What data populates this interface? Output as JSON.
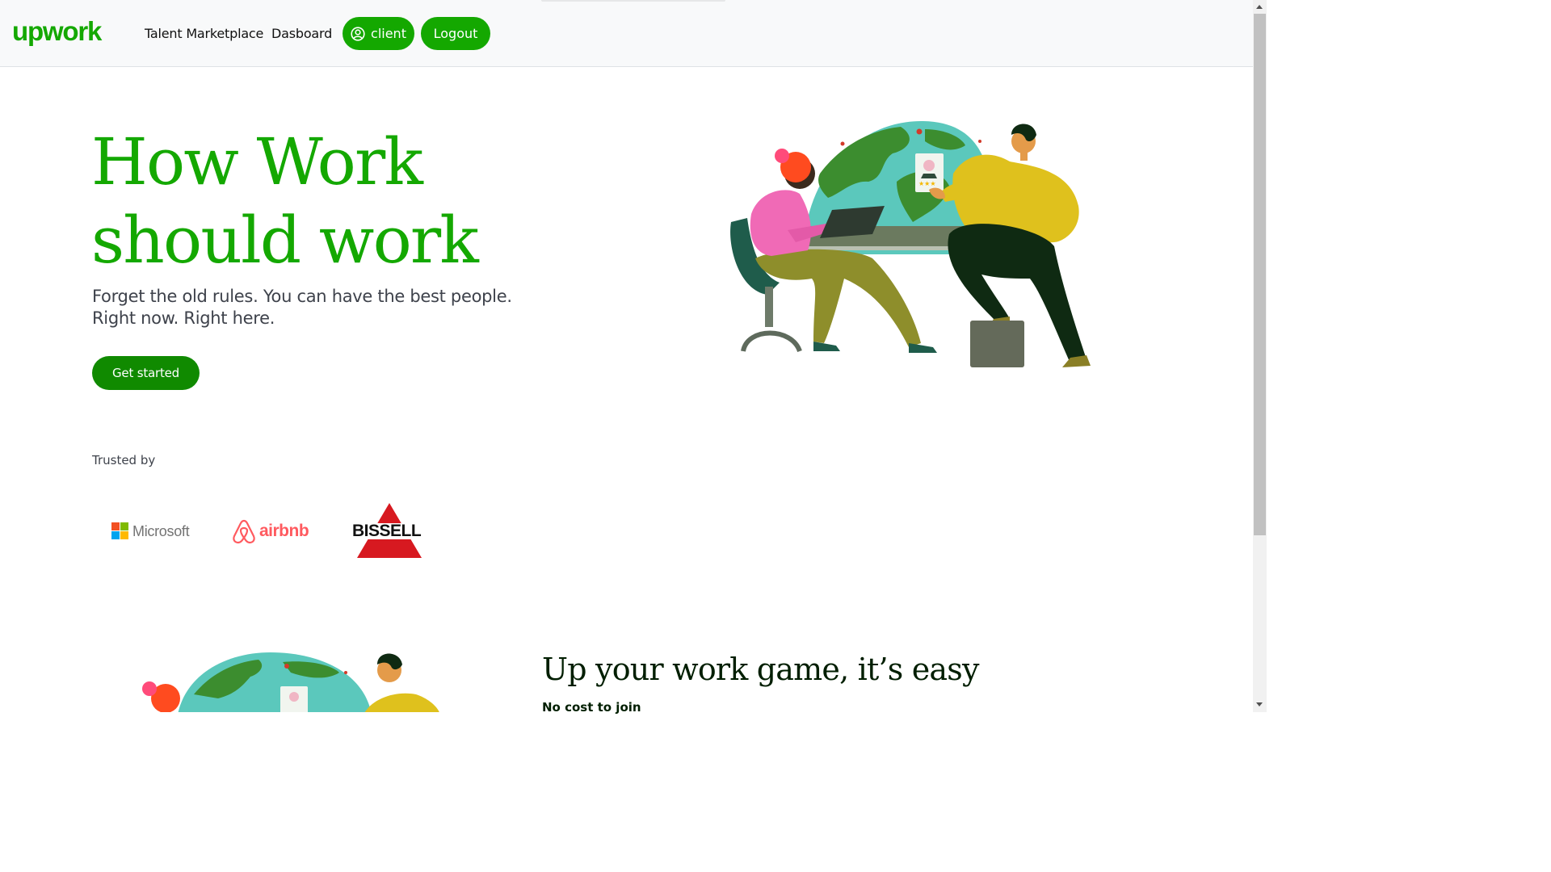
{
  "header": {
    "logo_text": "upwork",
    "nav": {
      "talent_marketplace": "Talent Marketplace",
      "dashboard": "Dasboard"
    },
    "client_label": "client",
    "logout_label": "Logout"
  },
  "hero": {
    "title_line1": "How Work",
    "title_line2": "should work",
    "subtitle_line1": "Forget the old rules. You can have the best people.",
    "subtitle_line2": "Right now. Right here.",
    "cta_label": "Get started"
  },
  "trusted": {
    "label": "Trusted by",
    "brands": [
      "Microsoft",
      "airbnb",
      "BISSELL"
    ]
  },
  "section2": {
    "title": "Up your work game, it’s easy",
    "subtitle": "No cost to join"
  },
  "colors": {
    "brand_green": "#14a800",
    "cta_green": "#108a00",
    "text_dark": "#001e00",
    "text_gray": "#3e424b"
  },
  "icons": [
    "user-circle-icon",
    "microsoft-logo-icon",
    "airbnb-logo-icon",
    "bissell-logo-icon"
  ]
}
